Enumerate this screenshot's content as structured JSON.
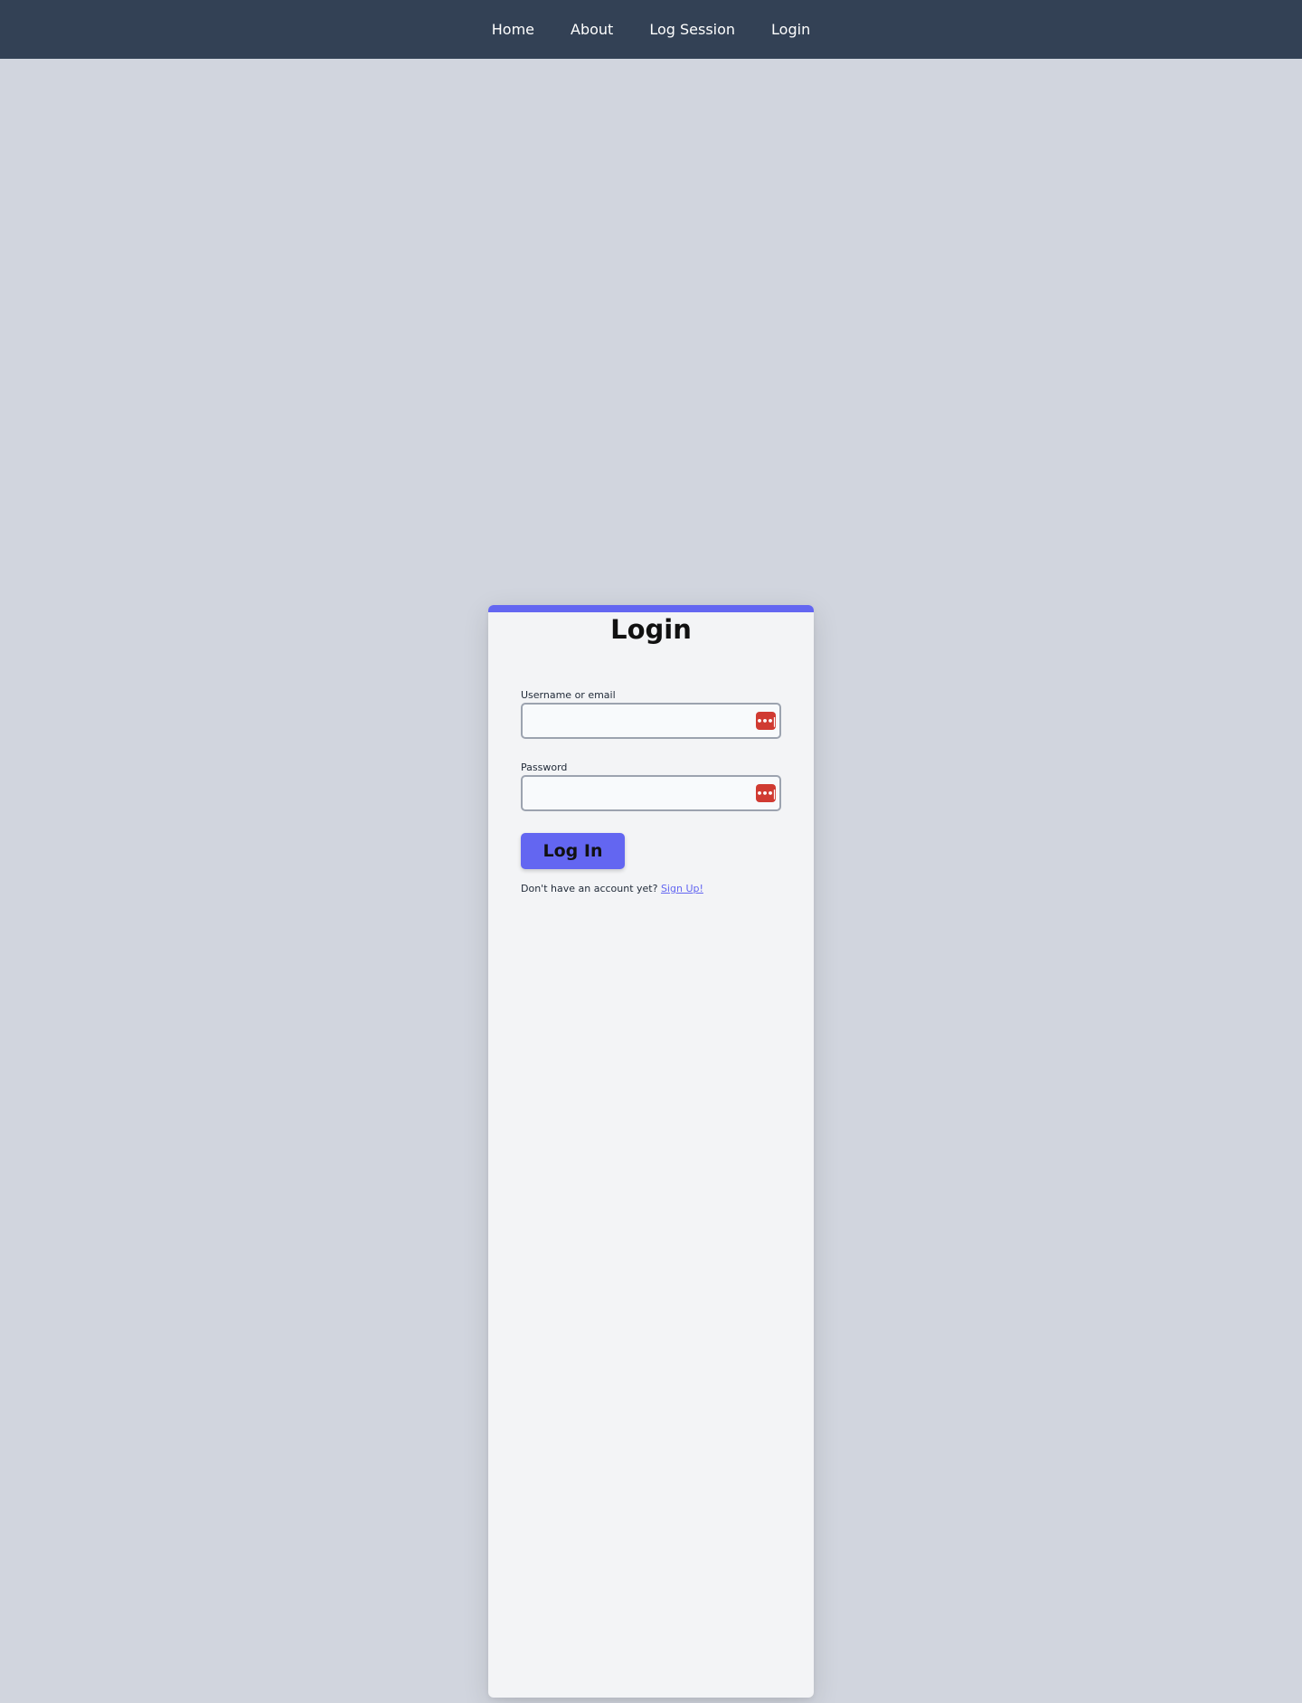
{
  "nav": {
    "items": [
      {
        "label": "Home"
      },
      {
        "label": "About"
      },
      {
        "label": "Log Session"
      },
      {
        "label": "Login"
      }
    ]
  },
  "login_card": {
    "title": "Login",
    "username": {
      "label": "Username or email",
      "value": "",
      "icon": "password-manager-icon"
    },
    "password": {
      "label": "Password",
      "value": "",
      "icon": "password-manager-icon"
    },
    "submit_label": "Log In",
    "signup_prompt": "Don't have an account yet?",
    "signup_link": "Sign Up!"
  },
  "colors": {
    "background": "#d1d5de",
    "navbar": "#334155",
    "accent": "#6366f1",
    "card": "#f3f4f6",
    "password_manager_icon": "#d03b32"
  }
}
